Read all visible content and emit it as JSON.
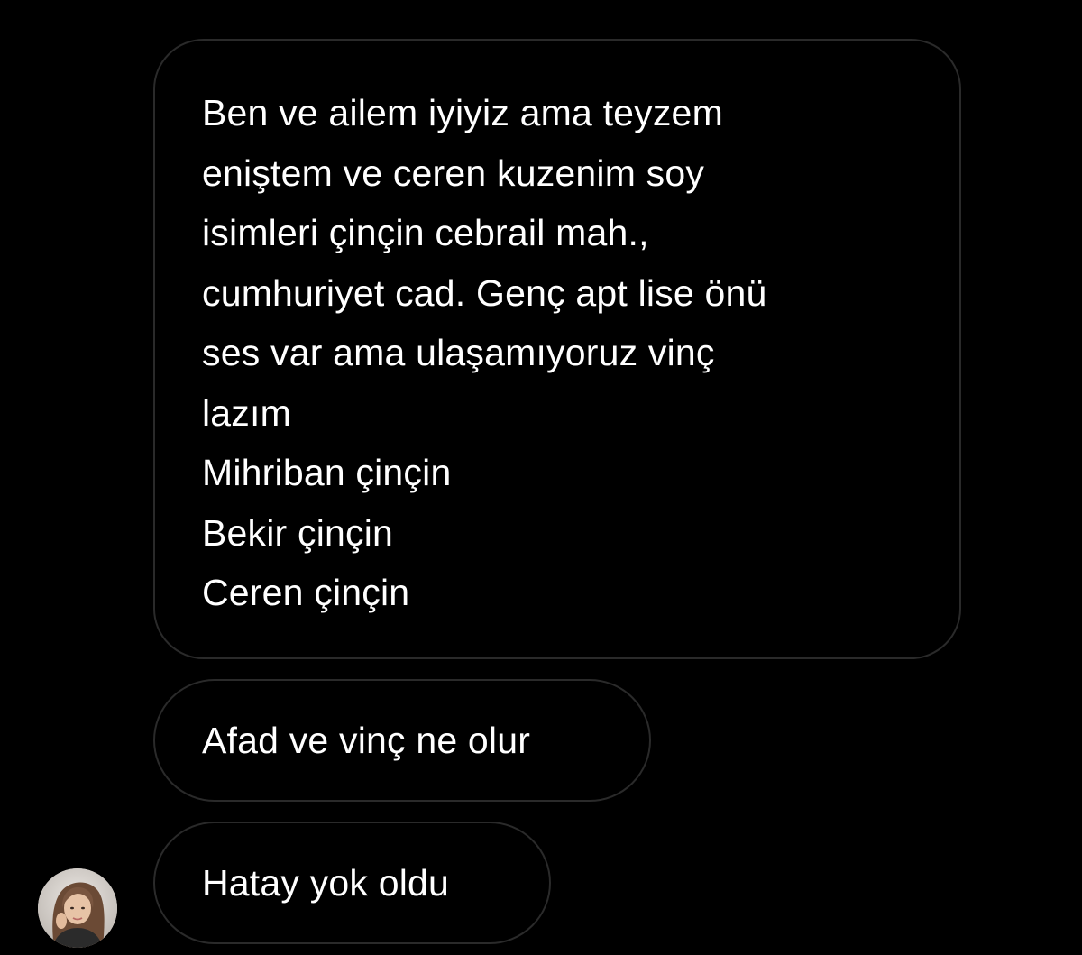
{
  "conversation": {
    "messages": [
      {
        "lines": [
          "Ben ve ailem iyiyiz ama teyzem",
          "eniştem ve ceren kuzenim soy",
          "isimleri çinçin cebrail mah.,",
          "cumhuriyet cad. Genç apt lise önü",
          "ses var ama ulaşamıyoruz vinç",
          "lazım",
          "Mihriban çinçin",
          "Bekir çinçin",
          "Ceren çinçin"
        ]
      },
      {
        "text": "Afad ve vinç ne olur"
      },
      {
        "text": "Hatay yok oldu"
      }
    ]
  },
  "sender": {
    "avatar_icon": "profile-photo"
  },
  "colors": {
    "background": "#000000",
    "bubble_border": "#2a2a2a",
    "text": "#ffffff"
  }
}
